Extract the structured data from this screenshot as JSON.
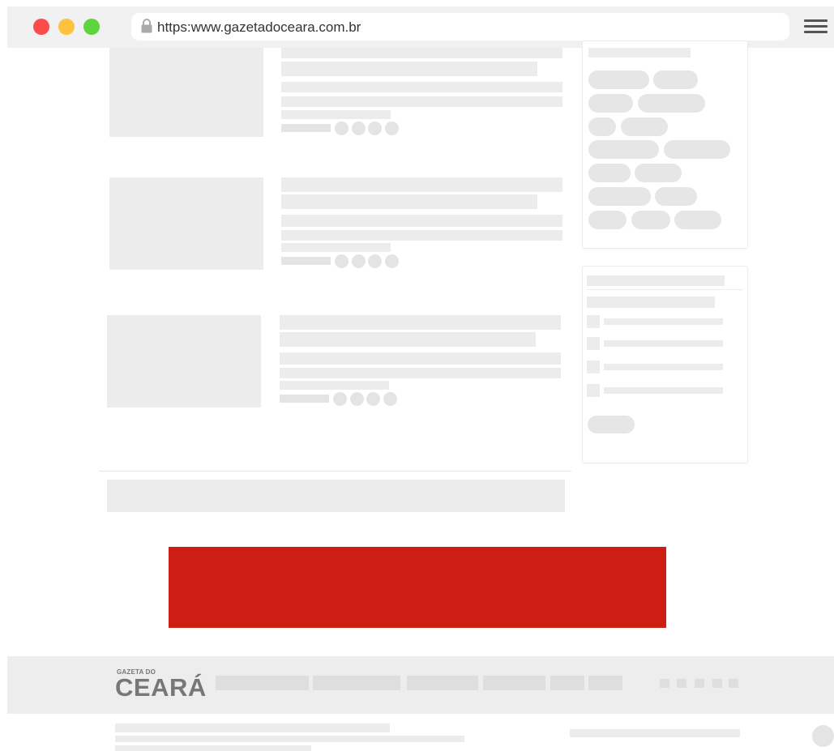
{
  "browser": {
    "url": "https:www.gazetadoceara.com.br",
    "traffic_lights": [
      "#fc4b4b",
      "#fdc23e",
      "#5ed43f"
    ]
  },
  "footer": {
    "logo_small": "GAZETA DO",
    "logo_big": "CEARÁ"
  },
  "colors": {
    "banner": "#cc1e12",
    "placeholder": "#ececec"
  },
  "icons": [
    "lock-icon",
    "hamburger-menu-icon"
  ]
}
